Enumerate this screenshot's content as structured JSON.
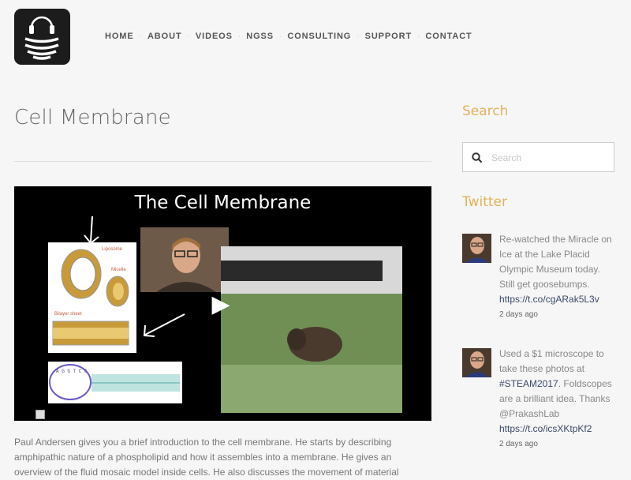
{
  "logo": {
    "icon": "audio-waves-logo-icon"
  },
  "nav": {
    "items": [
      "HOME",
      "ABOUT",
      "VIDEOS",
      "NGSS",
      "CONSULTING",
      "SUPPORT",
      "CONTACT"
    ]
  },
  "post": {
    "title": "Cell Membrane",
    "video": {
      "title": "The Cell Membrane",
      "play_icon": "▶",
      "labels": {
        "liposome": "Liposome",
        "micelle": "Micelle",
        "bilayer": "Bilayer sheet"
      }
    },
    "description": "Paul Andersen gives you a brief introduction to the cell membrane. He starts by describing amphipathic nature of a phospholipid and how it assembles into a membrane. He gives an overview of the fluid mosaic model inside cells. He also discusses the movement of material"
  },
  "sidebar": {
    "search_heading": "Search",
    "search_placeholder": "Search",
    "twitter_heading": "Twitter",
    "tweets": [
      {
        "text": "Re-watched the Miracle on Ice at the Lake Placid Olympic Museum today. Still get goosebumps.",
        "link": "https://t.co/cgARak5L3v",
        "time": "2 days ago"
      },
      {
        "text_before": "Used a $1 microscope to take these photos at",
        "hashtag": "#STEAM2017",
        "text_after": ". Foldscopes are a brilliant idea. Thanks",
        "mention": "@PrakashLab",
        "link": "https://t.co/icsXKtpKf2",
        "time": "2 days ago"
      }
    ]
  },
  "colors": {
    "accent": "#e0b35a",
    "link": "#3a4a6a",
    "background": "#f6f6f6"
  }
}
